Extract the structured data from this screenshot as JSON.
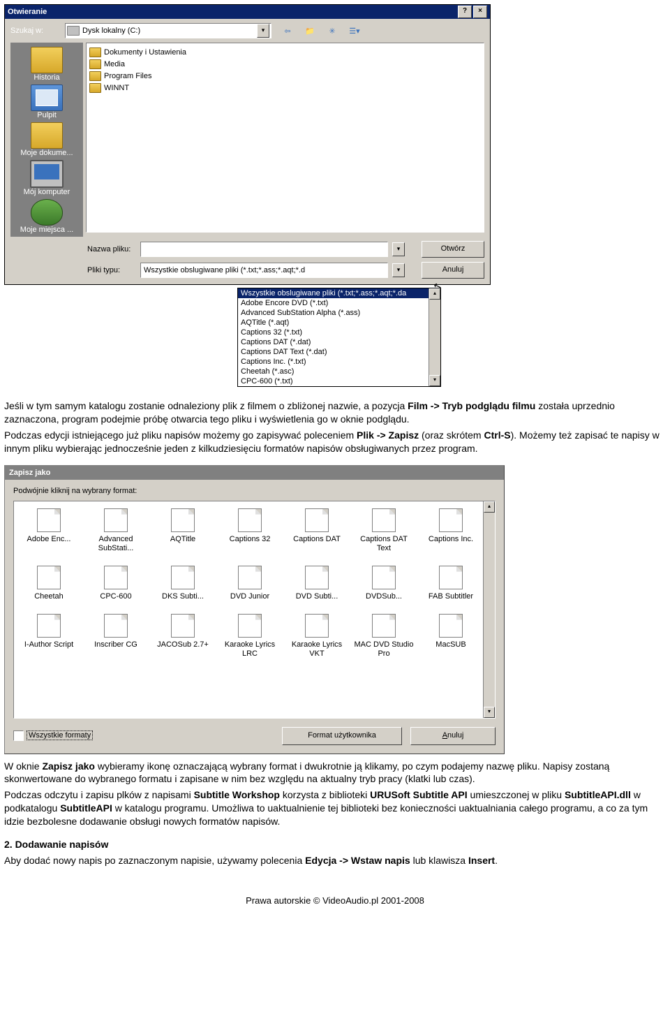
{
  "open_dialog": {
    "title": "Otwieranie",
    "help_btn": "?",
    "close_btn": "×",
    "lookin_label": "Szukaj w:",
    "drive": "Dysk lokalny (C:)",
    "places": {
      "history": "Historia",
      "desktop": "Pulpit",
      "mydocs": "Moje dokume...",
      "mycomp": "Mój komputer",
      "network": "Moje miejsca ..."
    },
    "folders": [
      "Dokumenty i Ustawienia",
      "Media",
      "Program Files",
      "WINNT"
    ],
    "filename_label": "Nazwa pliku:",
    "filetype_label": "Pliki typu:",
    "filetype_value": "Wszystkie obslugiwane pliki (*.txt;*.ass;*.aqt;*.d",
    "open_btn": "Otwórz",
    "cancel_btn": "Anuluj",
    "dropdown": [
      "Wszystkie obslugiwane pliki (*.txt;*.ass;*.aqt;*.da",
      "Adobe Encore DVD (*.txt)",
      "Advanced SubStation Alpha (*.ass)",
      "AQTitle (*.aqt)",
      "Captions 32 (*.txt)",
      "Captions DAT (*.dat)",
      "Captions DAT Text (*.dat)",
      "Captions Inc. (*.txt)",
      "Cheetah (*.asc)",
      "CPC-600 (*.txt)"
    ]
  },
  "para1_a": "Jeśli w tym samym katalogu zostanie odnaleziony plik z filmem o zbliżonej nazwie, a pozycja ",
  "para1_menu": "Film -> Tryb podglądu filmu",
  "para1_b": " została uprzednio zaznaczona, program podejmie próbę otwarcia tego pliku i wyświetlenia go w oknie podglądu.",
  "para2_a": "Podczas edycji istniejącego już pliku napisów możemy go zapisywać poleceniem ",
  "para2_cmd": "Plik -> Zapisz",
  "para2_b": " (oraz skrótem ",
  "para2_key": "Ctrl-S",
  "para2_c": "). Możemy też zapisać te napisy w innym pliku wybierając jednocześnie jeden z kilkudziesięciu formatów napisów obsługiwanych przez program.",
  "save_dialog": {
    "title": "Zapisz jako",
    "prompt": "Podwójnie kliknij na wybrany format:",
    "formats": [
      "Adobe Enc...",
      "Advanced SubStati...",
      "AQTitle",
      "Captions 32",
      "Captions DAT",
      "Captions DAT Text",
      "Captions Inc.",
      "Cheetah",
      "CPC-600",
      "DKS Subti...",
      "DVD Junior",
      "DVD Subti...",
      "DVDSub...",
      "FAB Subtitler",
      "I-Author Script",
      "Inscriber CG",
      "JACOSub 2.7+",
      "Karaoke Lyrics LRC",
      "Karaoke Lyrics VKT",
      "MAC DVD Studio Pro",
      "MacSUB"
    ],
    "all_formats": "Wszystkie formaty",
    "user_format_btn": "Format użytkownika",
    "cancel_btn_html": "Anuluj",
    "cancel_under": "A",
    "cancel_rest": "nuluj"
  },
  "para3_a": "W oknie ",
  "para3_win": "Zapisz jako",
  "para3_b": " wybieramy ikonę oznaczającą wybrany format i dwukrotnie ją klikamy, po czym podajemy nazwę pliku. Napisy zostaną skonwertowane do wybranego formatu i zapisane w nim bez względu na aktualny tryb pracy (klatki lub czas).",
  "para4_a": "Podczas odczytu i zapisu plków z napisami ",
  "para4_app": "Subtitle Workshop",
  "para4_b": " korzysta z biblioteki ",
  "para4_lib": "URUSoft Subtitle API",
  "para4_c": " umieszczonej w pliku ",
  "para4_dll": "SubtitleAPI.dll",
  "para4_d": " w podkatalogu ",
  "para4_dir": "SubtitleAPI",
  "para4_e": " w katalogu programu. Umożliwa to uaktualnienie tej biblioteki bez konieczności uaktualniania całego programu, a co za tym idzie bezbolesne dodawanie obsługi nowych formatów napisów.",
  "sec2_hdr": "2. Dodawanie napisów",
  "sec2_a": "Aby dodać nowy napis po zaznaczonym napisie, używamy polecenia ",
  "sec2_cmd": "Edycja -> Wstaw napis",
  "sec2_b": " lub klawisza ",
  "sec2_key": "Insert",
  "sec2_c": ".",
  "footer": "Prawa autorskie © VideoAudio.pl 2001-2008"
}
